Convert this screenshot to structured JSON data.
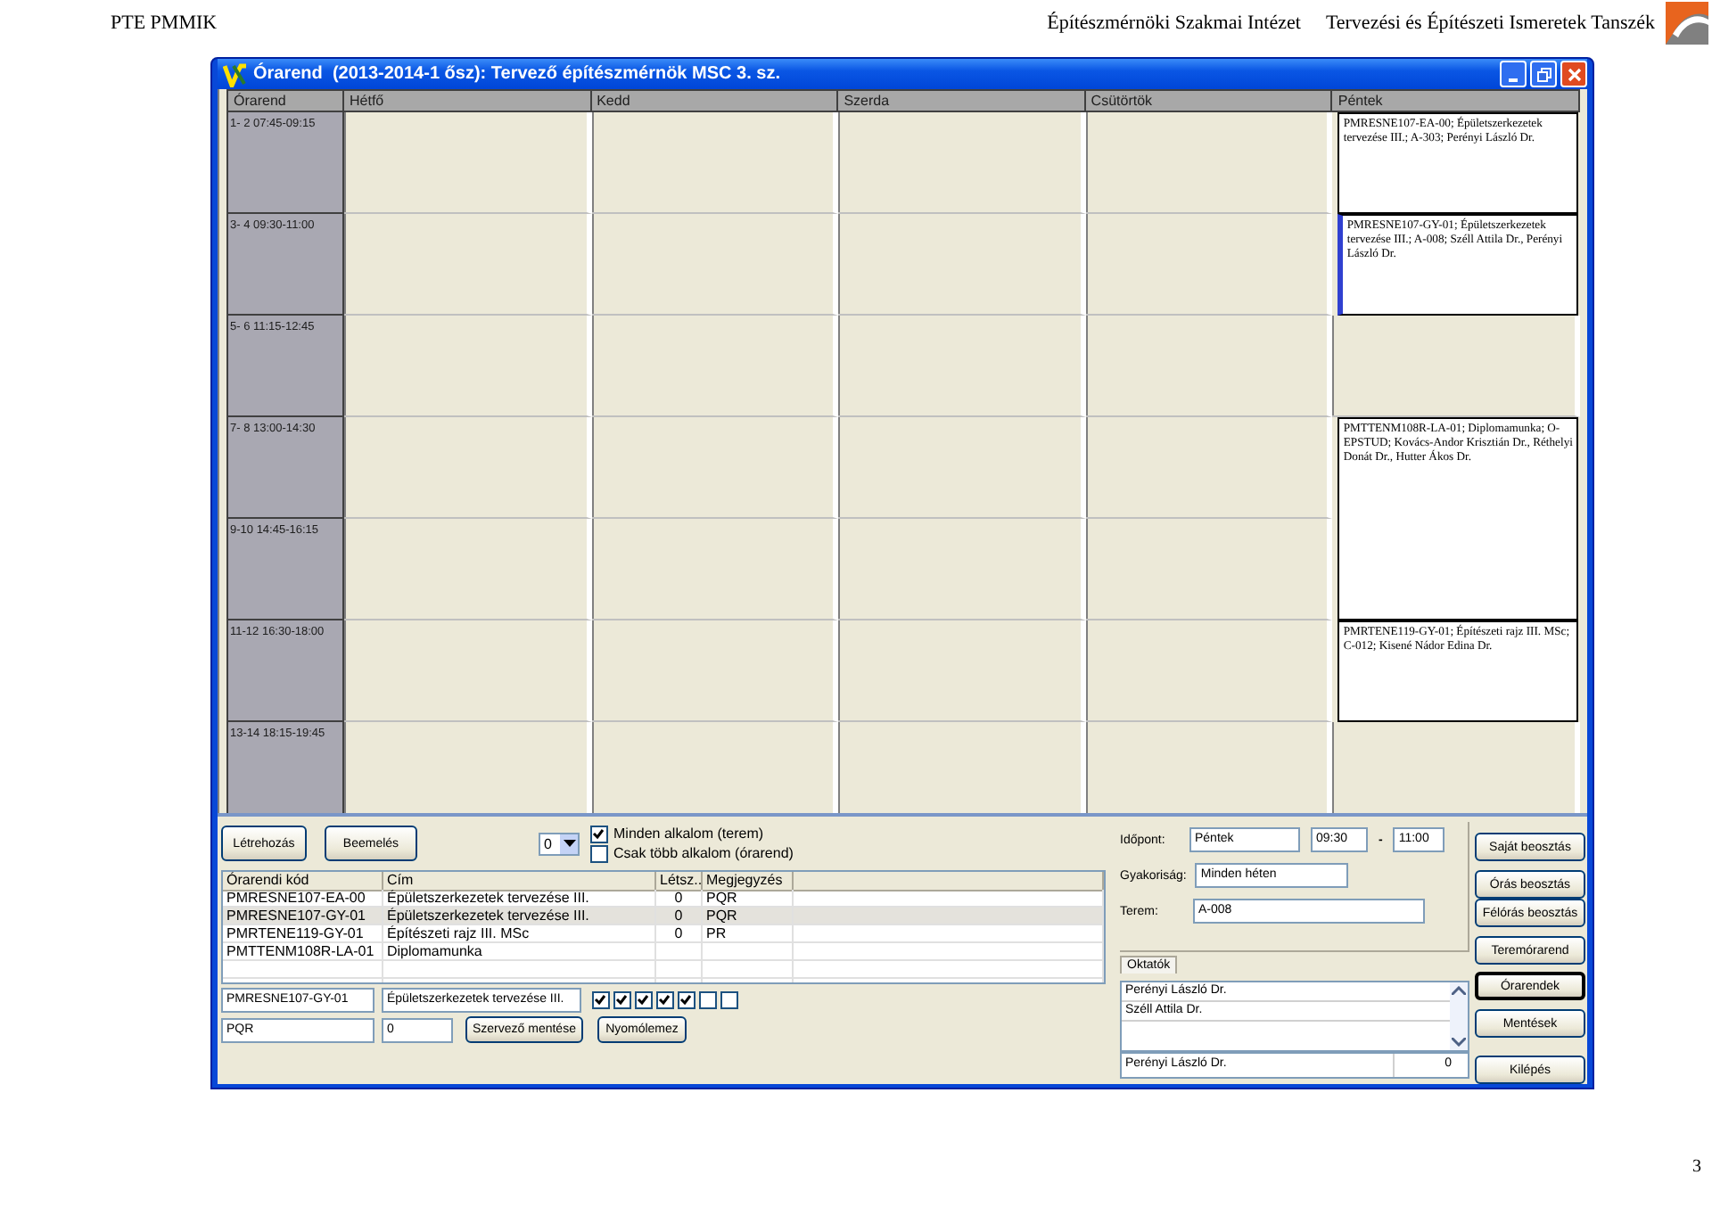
{
  "header": {
    "left": "PTE PMMIK",
    "center": "Építészmérnöki Szakmai Intézet",
    "right": "Tervezési és Építészeti Ismeretek Tanszék"
  },
  "window": {
    "title": "Órarend  (2013-2014-1 ősz): Tervező építészmérnök MSC 3. sz."
  },
  "timetable": {
    "corner": "Órarend",
    "slots": [
      "1- 2 07:45-09:15",
      "3- 4 09:30-11:00",
      "5- 6 11:15-12:45",
      "7- 8 13:00-14:30",
      "9-10 14:45-16:15",
      "11-12 16:30-18:00",
      "13-14 18:15-19:45"
    ],
    "days": [
      {
        "name": "Hétfő"
      },
      {
        "name": "Kedd"
      },
      {
        "name": "Szerda"
      },
      {
        "name": "Csütörtök"
      },
      {
        "name": "Péntek",
        "cells": [
          {
            "kind": "event",
            "text": "PMRESNE107-EA-00; Épületszerkezetek tervezése III.; A-303; Perényi László Dr.",
            "selected": false
          },
          {
            "kind": "event",
            "text": "PMRESNE107-GY-01; Épületszerkezetek tervezése III.; A-008; Széll Attila Dr., Perényi László Dr.",
            "selected": true
          },
          {
            "kind": "empty"
          },
          {
            "kind": "event",
            "text": "PMTTENM108R-LA-01; Diplomamunka; O-EPSTUD; Kovács-Andor Krisztián Dr., Réthelyi Donát Dr., Hutter Ákos Dr.",
            "selected": false
          },
          {
            "kind": "continued"
          },
          {
            "kind": "event",
            "text": "PMRTENE119-GY-01; Építészeti rajz III. MSc; C-012; Kisené Nádor Edina Dr.",
            "selected": false
          },
          {
            "kind": "empty"
          }
        ]
      }
    ]
  },
  "editor": {
    "buttons": [
      "Létrehozás",
      "Beemelés"
    ],
    "dropdown": "0",
    "options": [
      {
        "label": "Minden alkalom (terem)",
        "checked": true
      },
      {
        "label": "Csak több alkalom (órarend)",
        "checked": false
      }
    ],
    "columns": [
      "Órarendi kód",
      "Cím",
      "Létsz..",
      "Megjegyzés"
    ],
    "rows": [
      {
        "cells": [
          "PMRESNE107-EA-00",
          "Épületszerkezetek tervezése III.",
          "0",
          "PQR"
        ],
        "selected": false
      },
      {
        "cells": [
          "PMRESNE107-GY-01",
          "Épületszerkezetek tervezése III.",
          "0",
          "PQR"
        ],
        "selected": true
      },
      {
        "cells": [
          "PMRTENE119-GY-01",
          "Építészeti rajz III. MSc",
          "0",
          "PR"
        ],
        "selected": false
      },
      {
        "cells": [
          "PMTTENM108R-LA-01",
          "Diplomamunka",
          "",
          ""
        ],
        "selected": false
      }
    ],
    "code": "PMRESNE107-GY-01",
    "title": "Épületszerkezetek tervezése III.",
    "flags": [
      {
        "checked": true
      },
      {
        "checked": true
      },
      {
        "checked": true
      },
      {
        "checked": true
      },
      {
        "checked": true
      },
      {
        "checked": false
      },
      {
        "checked": false
      }
    ],
    "note": "PQR",
    "count": "0",
    "actions": [
      "Szervező mentése",
      "Nyomólemez"
    ]
  },
  "details": {
    "time_label": "Időpont:",
    "day": "Péntek",
    "from": "09:30",
    "dash": "-",
    "to": "11:00",
    "frequency_label": "Gyakoriság:",
    "frequency": "Minden héten",
    "room_label": "Terem:",
    "room": "A-008",
    "tab": "Oktatók",
    "teachers": [
      "Perényi László Dr.",
      "Széll Attila Dr."
    ],
    "teacher": "Perényi László Dr.",
    "teacher_count": "0"
  },
  "side_buttons": [
    {
      "label": "Saját beosztás",
      "default": false
    },
    {
      "label": "Órás beosztás",
      "default": false
    },
    {
      "label": "Félórás beosztás",
      "default": false
    },
    {
      "label": "Teremórarend",
      "default": false
    },
    {
      "label": "Órarendek",
      "default": true
    },
    {
      "label": "Mentések",
      "default": false
    },
    {
      "label": "Kilépés",
      "default": false
    }
  ],
  "page_number": "3"
}
